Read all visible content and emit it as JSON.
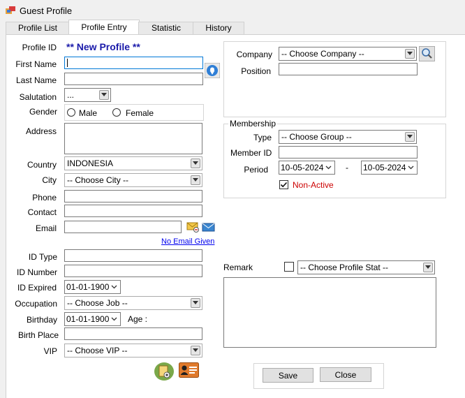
{
  "window": {
    "title": "Guest Profile"
  },
  "tabs": [
    {
      "label": "Profile List"
    },
    {
      "label": "Profile Entry"
    },
    {
      "label": "Statistic"
    },
    {
      "label": "History"
    }
  ],
  "left": {
    "profile_id_label": "Profile ID",
    "profile_id_value": "** New Profile **",
    "first_name_label": "First Name",
    "first_name_value": "",
    "last_name_label": "Last Name",
    "last_name_value": "",
    "salutation_label": "Salutation",
    "salutation_value": "...",
    "gender_label": "Gender",
    "gender_male": "Male",
    "gender_female": "Female",
    "address_label": "Address",
    "country_label": "Country",
    "country_value": "INDONESIA",
    "city_label": "City",
    "city_value": "-- Choose City --",
    "phone_label": "Phone",
    "contact_label": "Contact",
    "email_label": "Email",
    "no_email_link": "No Email Given",
    "id_type_label": "ID Type",
    "id_number_label": "ID Number",
    "id_expired_label": "ID Expired",
    "id_expired_value": "01-01-1900",
    "occupation_label": "Occupation",
    "occupation_value": "-- Choose Job --",
    "birthday_label": "Birthday",
    "birthday_value": "01-01-1900",
    "age_label": "Age :",
    "birth_place_label": "Birth Place",
    "vip_label": "VIP",
    "vip_value": "-- Choose VIP --"
  },
  "company": {
    "company_label": "Company",
    "company_value": "-- Choose Company --",
    "position_label": "Position"
  },
  "membership": {
    "group_label": "Membership",
    "type_label": "Type",
    "type_value": "-- Choose Group --",
    "member_id_label": "Member ID",
    "period_label": "Period",
    "period_from": "10-05-2024",
    "period_sep": "-",
    "period_to": "10-05-2024",
    "non_active_label": "Non-Active",
    "non_active_checked": true
  },
  "remark": {
    "label": "Remark",
    "profile_stat_value": "-- Choose Profile Stat --"
  },
  "actions": {
    "save_label": "Save",
    "close_label": "Close"
  },
  "colors": {
    "profile_id": "#1a1aaa",
    "non_active": "#cc0000",
    "link": "#0000ee",
    "focus_border": "#0078d7"
  }
}
